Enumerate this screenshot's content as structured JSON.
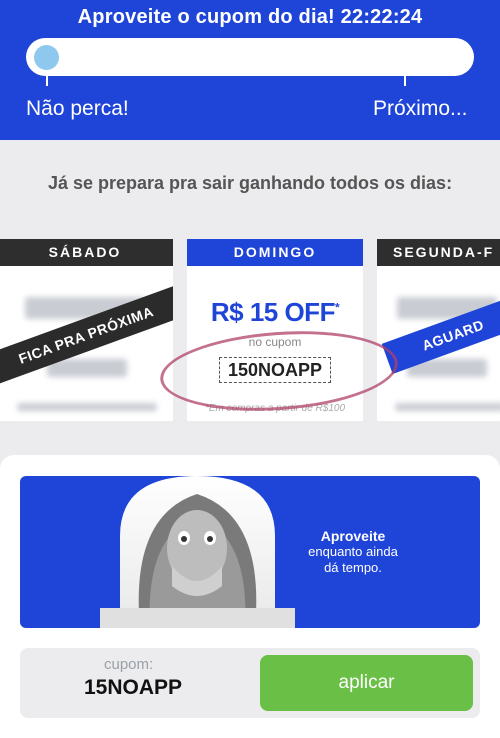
{
  "header": {
    "title": "Aproveite o cupom do dia!",
    "time": "22:22:24",
    "progress_left_label": "Não perca!",
    "progress_right_label": "Próximo...",
    "progress_fraction": 0.02
  },
  "subtitle": "Já se prepara pra sair ganhando todos os dias:",
  "days": [
    {
      "day": "SÁBADO",
      "ribbon": "FICA PRA PRÓXIMA"
    },
    {
      "day": "DOMINGO",
      "offer": "R$ 15 OFF",
      "offer_mark": "*",
      "caption": "no cupom",
      "code": "150NOAPP",
      "footnote": "*Em compras a partir de R$100"
    },
    {
      "day": "SEGUNDA-F",
      "ribbon": "AGUARD"
    }
  ],
  "banner": {
    "line1": "Aproveite",
    "line2": "enquanto ainda",
    "line3": "dá tempo."
  },
  "coupon": {
    "caption": "cupom:",
    "code": "15NOAPP",
    "apply_label": "aplicar"
  },
  "colors": {
    "brand_blue": "#1f44d8",
    "apply_green": "#6abf46",
    "progress_knob": "#8fc8ee",
    "ribbon_dark": "#2b2b2b"
  }
}
